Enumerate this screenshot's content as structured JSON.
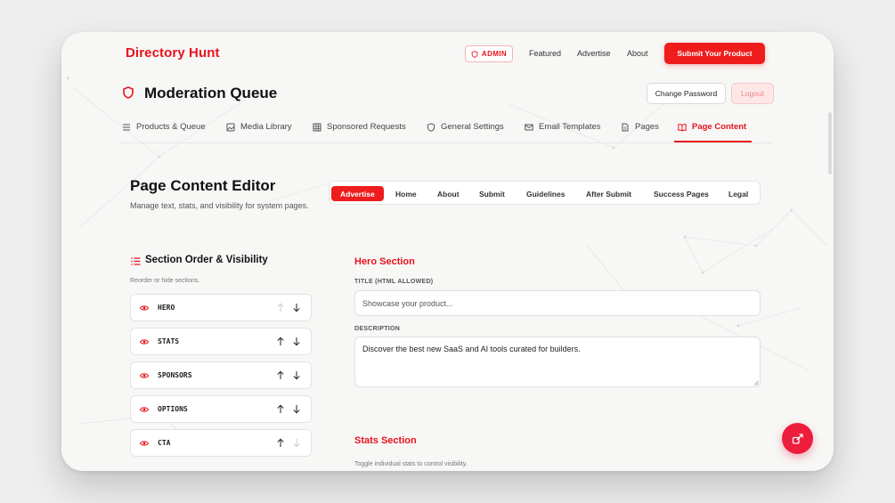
{
  "brand": "Directory Hunt",
  "header": {
    "admin_badge": "ADMIN",
    "nav": [
      "Featured",
      "Advertise",
      "About"
    ],
    "submit_label": "Submit Your Product"
  },
  "page": {
    "title": "Moderation Queue",
    "change_password": "Change Password",
    "logout": "Logout"
  },
  "tabs": [
    {
      "label": "Products & Queue",
      "icon": "list-icon"
    },
    {
      "label": "Media Library",
      "icon": "image-icon"
    },
    {
      "label": "Sponsored Requests",
      "icon": "grid-icon"
    },
    {
      "label": "General Settings",
      "icon": "shield-icon"
    },
    {
      "label": "Email Templates",
      "icon": "mail-icon"
    },
    {
      "label": "Pages",
      "icon": "file-icon"
    },
    {
      "label": "Page Content",
      "icon": "book-icon",
      "active": true
    }
  ],
  "editor": {
    "title": "Page Content Editor",
    "subtitle": "Manage text, stats, and visibility for system pages.",
    "subtabs": [
      "Advertise",
      "Home",
      "About",
      "Submit",
      "Guidelines",
      "After Submit",
      "Success Pages",
      "Legal"
    ],
    "active_subtab": "Advertise"
  },
  "sections_panel": {
    "title": "Section Order & Visibility",
    "hint": "Reorder or hide sections.",
    "items": [
      {
        "label": "HERO",
        "up_enabled": false,
        "down_enabled": true
      },
      {
        "label": "STATS",
        "up_enabled": true,
        "down_enabled": true
      },
      {
        "label": "SPONSORS",
        "up_enabled": true,
        "down_enabled": true
      },
      {
        "label": "OPTIONS",
        "up_enabled": true,
        "down_enabled": true
      },
      {
        "label": "CTA",
        "up_enabled": true,
        "down_enabled": false
      }
    ]
  },
  "hero": {
    "title": "Hero Section",
    "title_label": "TITLE (HTML ALLOWED)",
    "title_placeholder": "Showcase your product...",
    "description_label": "DESCRIPTION",
    "description_value": "Discover the best new SaaS and AI tools curated for builders."
  },
  "stats": {
    "title": "Stats Section",
    "hint": "Toggle individual stats to control visibility."
  },
  "colors": {
    "accent": "#e8131d",
    "background": "#f7f7f6"
  }
}
